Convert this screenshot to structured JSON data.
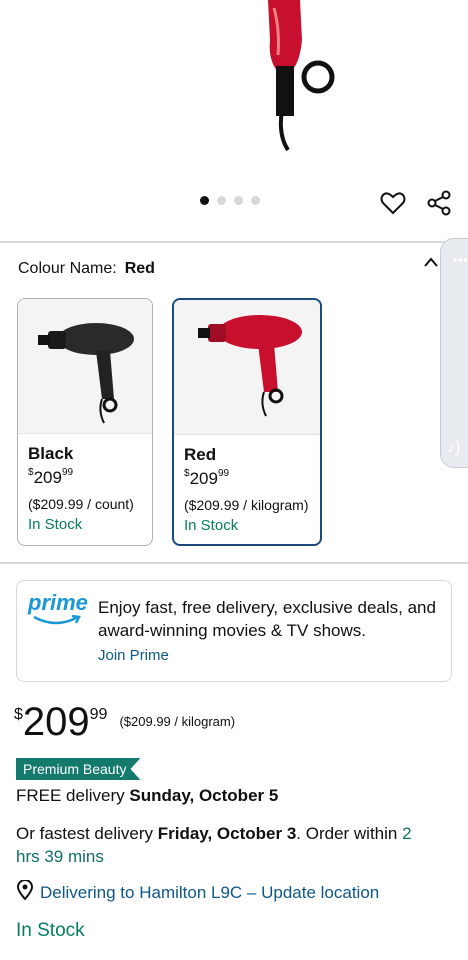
{
  "carousel": {
    "dots": 4,
    "active_index": 0
  },
  "colour": {
    "label": "Colour Name:",
    "selected": "Red"
  },
  "variants": [
    {
      "name": "Black",
      "currency": "$",
      "whole": "209",
      "fraction": "99",
      "per_unit": "($209.99 / count)",
      "stock": "In Stock"
    },
    {
      "name": "Red",
      "currency": "$",
      "whole": "209",
      "fraction": "99",
      "per_unit": "($209.99 / kilogram)",
      "stock": "In Stock"
    }
  ],
  "prime": {
    "logo_text": "prime",
    "message": "Enjoy fast, free delivery, exclusive deals, and award-winning movies & TV shows.",
    "join_label": "Join Prime"
  },
  "price": {
    "currency": "$",
    "whole": "209",
    "fraction": "99",
    "per_unit": "($209.99 / kilogram)"
  },
  "badge": "Premium Beauty",
  "delivery": {
    "free_prefix": "FREE delivery ",
    "free_date": "Sunday, October 5",
    "fastest_prefix": "Or fastest delivery ",
    "fastest_date": "Friday, October 3",
    "order_within": ". Order within ",
    "countdown_line1": "2",
    "countdown_line2": "hrs 39 mins"
  },
  "location": {
    "text": "Delivering to Hamilton L9C – Update location"
  },
  "availability": "In Stock",
  "colors": {
    "stock_green": "#067d62",
    "link_blue": "#0f5787",
    "badge_teal": "#147a6e",
    "selected_border": "#1b4a7d",
    "dryer_red": "#c8102e"
  }
}
